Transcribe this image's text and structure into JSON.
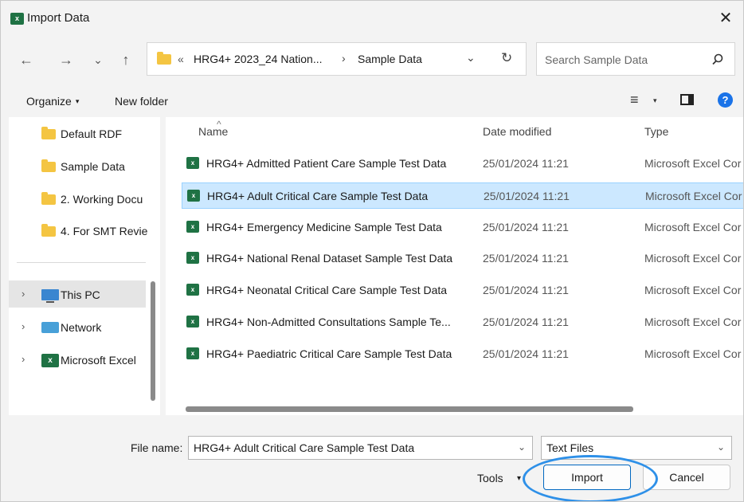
{
  "window": {
    "title": "Import Data",
    "close_glyph": "✕",
    "app_icon_text": "x"
  },
  "navigation": {
    "back_glyph": "←",
    "forward_glyph": "→",
    "history_glyph": "⌄",
    "up_glyph": "↑",
    "address": {
      "prefix": "«",
      "crumb_1": "HRG4+ 2023_24 Nation...",
      "separator": "›",
      "crumb_2": "Sample Data",
      "dropdown_glyph": "⌄",
      "refresh_glyph": "↻"
    },
    "search_placeholder": "Search Sample Data"
  },
  "commands": {
    "organize": "Organize",
    "organize_caret": "▾",
    "new_folder": "New folder",
    "view_glyph": "≡",
    "view_caret": "▾",
    "help_glyph": "?"
  },
  "nav_pane": {
    "folders": [
      {
        "label": "Default RDF"
      },
      {
        "label": "Sample Data"
      },
      {
        "label": "2. Working Docu"
      },
      {
        "label": "4. For SMT Revie"
      }
    ],
    "locations": [
      {
        "label": "This PC",
        "chevron": "›",
        "icon": "computer-icon"
      },
      {
        "label": "Network",
        "chevron": "›",
        "icon": "network-icon"
      },
      {
        "label": "Microsoft Excel",
        "chevron": "›",
        "icon": "excel-icon"
      }
    ]
  },
  "file_list": {
    "columns": {
      "name": "Name",
      "date": "Date modified",
      "type": "Type",
      "sort_glyph": "^"
    },
    "selected_index": 1,
    "rows": [
      {
        "name": "HRG4+ Admitted Patient Care Sample Test Data",
        "date": "25/01/2024 11:21",
        "type": "Microsoft Excel Cor"
      },
      {
        "name": "HRG4+ Adult Critical Care Sample Test Data",
        "date": "25/01/2024 11:21",
        "type": "Microsoft Excel Cor"
      },
      {
        "name": "HRG4+ Emergency Medicine Sample Test Data",
        "date": "25/01/2024 11:21",
        "type": "Microsoft Excel Cor"
      },
      {
        "name": "HRG4+ National Renal Dataset Sample Test Data",
        "date": "25/01/2024 11:21",
        "type": "Microsoft Excel Cor"
      },
      {
        "name": "HRG4+ Neonatal Critical Care Sample Test Data",
        "date": "25/01/2024 11:21",
        "type": "Microsoft Excel Cor"
      },
      {
        "name": "HRG4+ Non-Admitted Consultations Sample Te...",
        "date": "25/01/2024 11:21",
        "type": "Microsoft Excel Cor"
      },
      {
        "name": "HRG4+ Paediatric Critical Care Sample Test Data",
        "date": "25/01/2024 11:21",
        "type": "Microsoft Excel Cor"
      }
    ],
    "file_icon_text": "x"
  },
  "footer": {
    "file_name_label": "File name:",
    "file_name_value": "HRG4+ Adult Critical Care Sample Test Data",
    "file_type_value": "Text Files",
    "dropdown_glyph": "⌄",
    "tools_label": "Tools",
    "tools_caret": "▾",
    "import_label": "Import",
    "cancel_label": "Cancel"
  },
  "colors": {
    "selection": "#cce8ff",
    "excel_green": "#1f7244",
    "folder_yellow": "#f4c542",
    "highlight_annotation": "#2e90e8"
  }
}
